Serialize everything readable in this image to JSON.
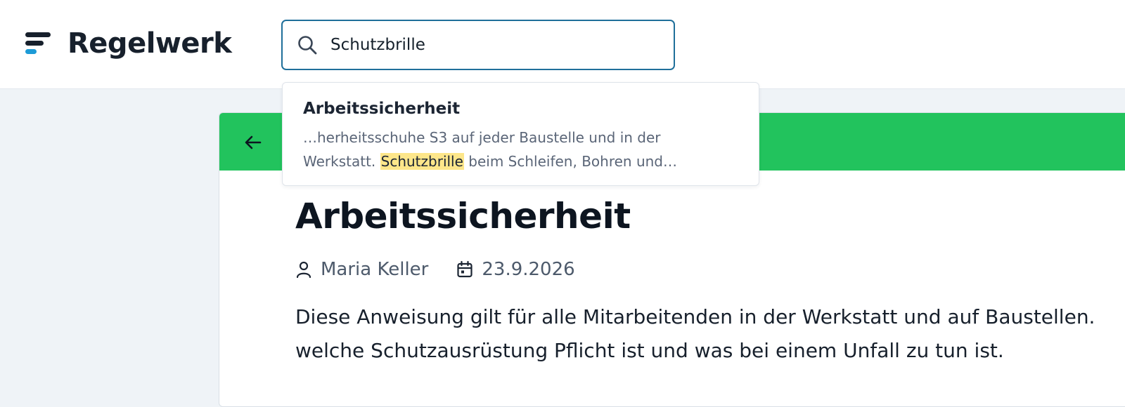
{
  "header": {
    "brand": "Regelwerk",
    "logo_icon": "stacked-lines-logo-icon"
  },
  "search": {
    "value": "Schutzbrille",
    "icon": "search-icon"
  },
  "suggestions": [
    {
      "title": "Arbeitssicherheit",
      "snippet_before_line1": "…herheitsschuhe S3 auf jeder Baustelle und in der",
      "snippet_before_line2": "Werkstatt. ",
      "snippet_highlight": "Schutzbrille",
      "snippet_after": " beim Schleifen, Bohren und…"
    }
  ],
  "article": {
    "accent_color": "#22c35d",
    "back_icon": "arrow-left-icon",
    "title": "Arbeitssicherheit",
    "author": "Maria Keller",
    "date": "23.9.2026",
    "body_line1": "Diese Anweisung gilt für alle Mitarbeitenden in der Werkstatt und auf Baustellen.",
    "body_line2": "welche Schutzausrüstung Pflicht ist und was bei einem Unfall zu tun ist."
  },
  "colors": {
    "search_border": "#1f6f9a",
    "highlight": "#fde68a",
    "logo_accent": "#1d9bd7"
  }
}
